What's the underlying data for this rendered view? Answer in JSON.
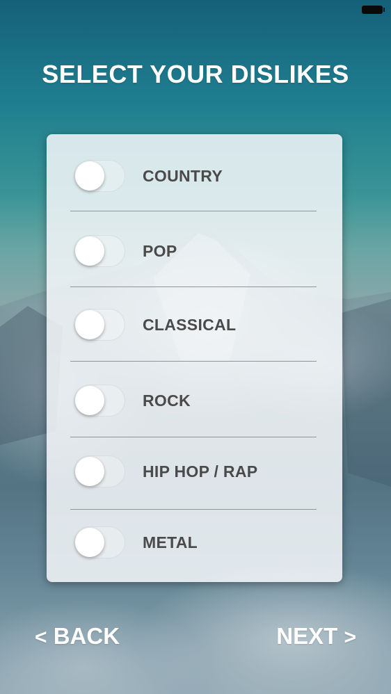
{
  "header": {
    "title": "SELECT YOUR DISLIKES"
  },
  "genres": [
    {
      "label": "COUNTRY",
      "on": false
    },
    {
      "label": "POP",
      "on": false
    },
    {
      "label": "CLASSICAL",
      "on": false
    },
    {
      "label": "ROCK",
      "on": false
    },
    {
      "label": "HIP HOP / RAP",
      "on": false
    },
    {
      "label": "METAL",
      "on": false
    }
  ],
  "footer": {
    "back_chevron": "<",
    "back_label": "BACK",
    "next_label": "NEXT",
    "next_chevron": ">"
  },
  "colors": {
    "label_text": "#4a4a4a",
    "title_text": "#ffffff",
    "card_bg": "#f4f7f9"
  }
}
